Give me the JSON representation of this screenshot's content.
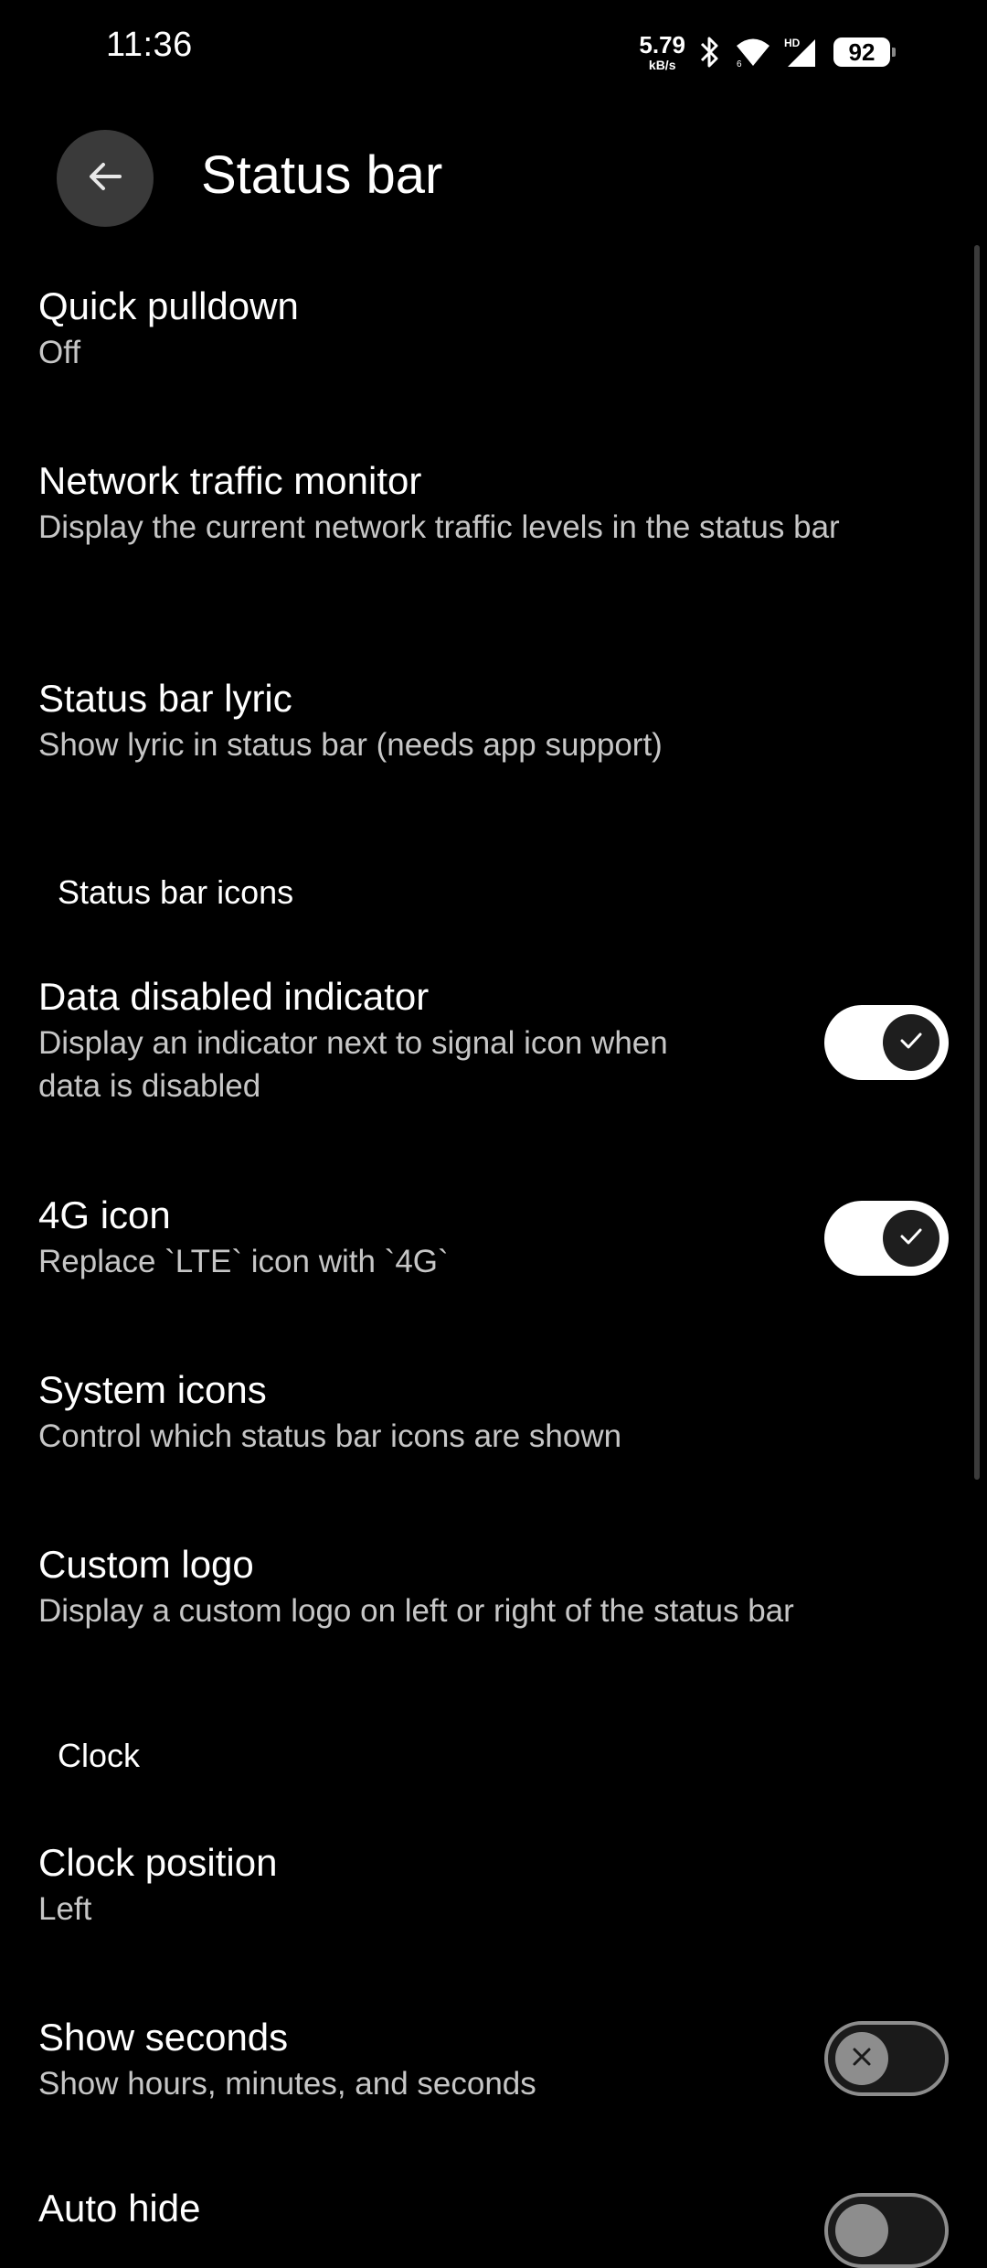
{
  "status_bar": {
    "time": "11:36",
    "net_speed_value": "5.79",
    "net_speed_unit": "kB/s",
    "battery": "92"
  },
  "header": {
    "title": "Status bar"
  },
  "items": {
    "quick_pulldown": {
      "title": "Quick pulldown",
      "subtitle": "Off"
    },
    "network_traffic": {
      "title": "Network traffic monitor",
      "subtitle": "Display the current network traffic levels in the status bar"
    },
    "lyric": {
      "title": "Status bar lyric",
      "subtitle": "Show lyric in status bar (needs app support)"
    },
    "data_disabled": {
      "title": "Data disabled indicator",
      "subtitle": "Display an indicator next to signal icon when data is disabled",
      "enabled": true
    },
    "icon_4g": {
      "title": "4G icon",
      "subtitle": "Replace `LTE` icon with `4G`",
      "enabled": true
    },
    "system_icons": {
      "title": "System icons",
      "subtitle": "Control which status bar icons are shown"
    },
    "custom_logo": {
      "title": "Custom logo",
      "subtitle": "Display a custom logo on left or right of the status bar"
    },
    "clock_position": {
      "title": "Clock position",
      "subtitle": "Left"
    },
    "show_seconds": {
      "title": "Show seconds",
      "subtitle": "Show hours, minutes, and seconds",
      "enabled": false
    },
    "auto_hide": {
      "title": "Auto hide"
    }
  },
  "sections": {
    "status_bar_icons": "Status bar icons",
    "clock": "Clock"
  },
  "colors": {
    "background": "#000000",
    "toggle_on": "#ffffff",
    "toggle_off_border": "#8d8d8d"
  }
}
